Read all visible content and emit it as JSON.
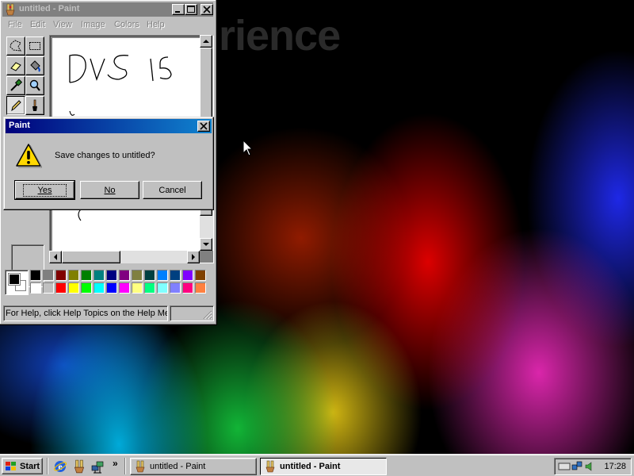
{
  "wallpaper": {
    "watermark_text": "rience"
  },
  "paint_window": {
    "title": "untitled - Paint",
    "title_buttons": [
      "minimize",
      "maximize",
      "close"
    ],
    "menu": [
      {
        "label": "File"
      },
      {
        "label": "Edit"
      },
      {
        "label": "View"
      },
      {
        "label": "Image"
      },
      {
        "label": "Colors"
      },
      {
        "label": "Help"
      }
    ],
    "tools": [
      {
        "name": "free-form-select-icon",
        "active": false
      },
      {
        "name": "rect-select-icon",
        "active": false
      },
      {
        "name": "eraser-icon",
        "active": false
      },
      {
        "name": "fill-bucket-icon",
        "active": false
      },
      {
        "name": "color-picker-icon",
        "active": false
      },
      {
        "name": "magnifier-icon",
        "active": false
      },
      {
        "name": "pencil-icon",
        "active": true
      },
      {
        "name": "brush-icon",
        "active": false
      }
    ],
    "canvas_text": "DVS 15",
    "palette": {
      "foreground": "#000000",
      "background": "#ffffff",
      "colors": [
        "#000000",
        "#808080",
        "#800000",
        "#808000",
        "#008000",
        "#008080",
        "#000080",
        "#800080",
        "#808040",
        "#004040",
        "#0080ff",
        "#004080",
        "#8000ff",
        "#804000",
        "#ffffff",
        "#c0c0c0",
        "#ff0000",
        "#ffff00",
        "#00ff00",
        "#00ffff",
        "#0000ff",
        "#ff00ff",
        "#ffff80",
        "#00ff80",
        "#80ffff",
        "#8080ff",
        "#ff0080",
        "#ff8040"
      ]
    },
    "status_text": "For Help, click Help Topics on the Help Me"
  },
  "dialog": {
    "title": "Paint",
    "message": "Save changes to untitled?",
    "icon": "warning-icon",
    "buttons": {
      "yes": "Yes",
      "no": "No",
      "cancel": "Cancel"
    }
  },
  "taskbar": {
    "start_label": "Start",
    "quick_launch": [
      "ie-icon",
      "paint-icon",
      "network-icon"
    ],
    "chevron": "»",
    "tasks": [
      {
        "label": "untitled - Paint",
        "active": false
      },
      {
        "label": "untitled - Paint",
        "active": true
      }
    ],
    "clock": "17:28"
  }
}
